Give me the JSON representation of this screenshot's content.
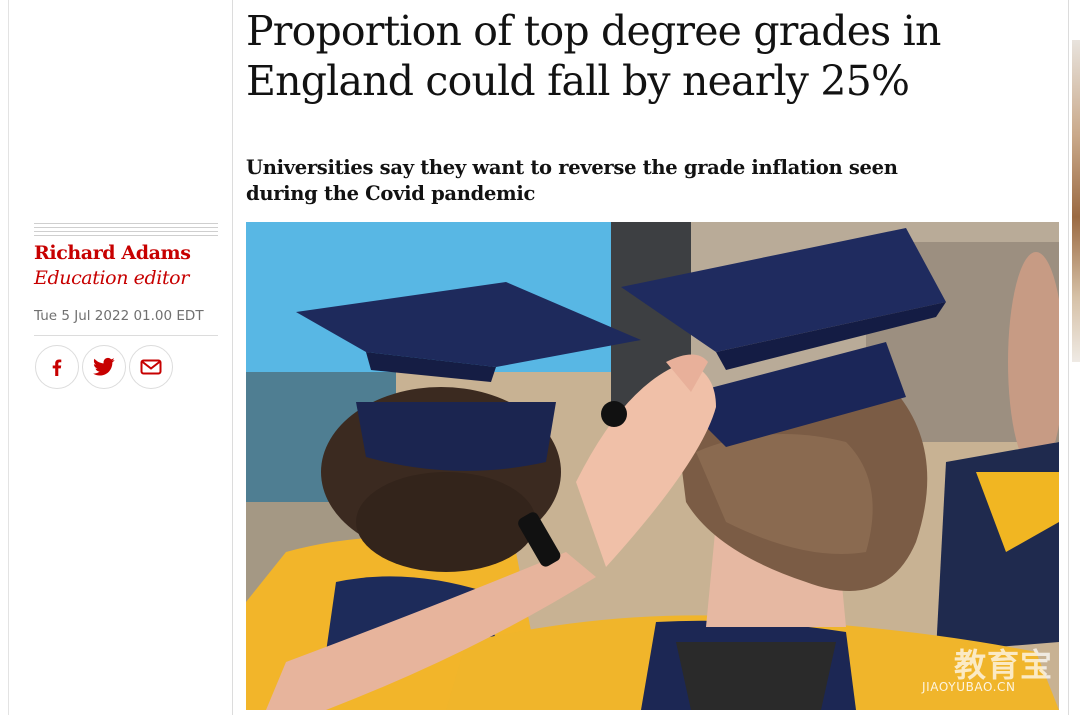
{
  "article": {
    "headline": "Proportion of top degree grades in England could fall by nearly 25%",
    "standfirst": "Universities say they want to reverse the grade inflation seen during the Covid pandemic"
  },
  "byline": {
    "name": "Richard Adams",
    "role": "Education editor",
    "date": "Tue 5 Jul 2022 01.00 EDT"
  },
  "share": {
    "icons": [
      "facebook-icon",
      "twitter-icon",
      "email-icon"
    ]
  },
  "watermark": {
    "chinese": "教育宝",
    "latin": "JIAOYUBAO.CN"
  },
  "colors": {
    "accent": "#c70000",
    "text": "#121212",
    "muted": "#707070",
    "border": "#dcdcdc"
  }
}
